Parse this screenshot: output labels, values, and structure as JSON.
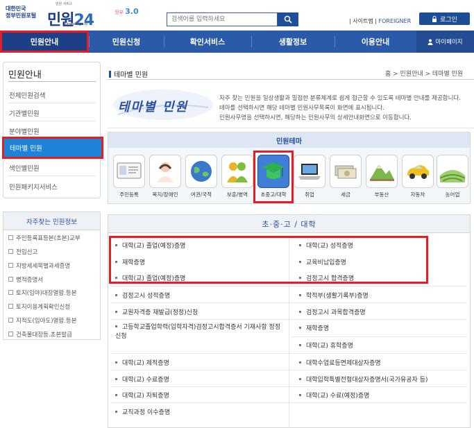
{
  "header": {
    "gov_logo": "대한민국\n정부민원포털",
    "tagline": "민원 서비스",
    "brand": "민원",
    "brand_num": "24",
    "url": "minwon.go.kr",
    "gov30_label": "정부",
    "gov30_num": "3.0",
    "search_placeholder": "검색어를 입력하세요",
    "sitemap": "사이트맵",
    "foreigner": "FOREIGNER",
    "login": "로그인"
  },
  "nav": {
    "items": [
      "민원안내",
      "민원신청",
      "확인서비스",
      "생활정보",
      "이용안내"
    ],
    "mypage": "마이페이지"
  },
  "sidebar": {
    "title": "민원안내",
    "items": [
      "전체민원검색",
      "기관별민원",
      "분야별민원",
      "테마별 민원",
      "색인별민원",
      "민원패키지서비스"
    ],
    "freq_title": "자주찾는 민원정보",
    "freq_items": [
      "주민등록표등본(초본)교부",
      "전입신고",
      "지방세세목별과세증명",
      "병적증명서",
      "토지(임야)대장열람.등본",
      "토지이용계획확인신청",
      "지적도(임야도)열람.등본",
      "건축물대장등.초본발급"
    ]
  },
  "content": {
    "page_title": "테마별 민원",
    "breadcrumb": "홈 > 민원안내 > 테마별 민원",
    "hero_title": "테마별 민원",
    "hero_desc": [
      "자주 찾는 민원을 일상생활과 밀접한 분류체계로 쉽게 접근할 수 있도록 테마별 안내를 제공합니다.",
      "테마를 선택하시면 해당 테마별 민원사무목록이 화면에 표시됩니다.",
      "민원사무명을 선택하시면, 해당하는 민원사무의 상세안내화면으로 이동합니다."
    ],
    "theme_header": "민원테마",
    "themes": [
      {
        "label": "주민등록",
        "icon": "id-card-icon"
      },
      {
        "label": "복지/장애인",
        "icon": "welfare-icon"
      },
      {
        "label": "여권/국적",
        "icon": "globe-icon"
      },
      {
        "label": "보훈/병역",
        "icon": "people-icon"
      },
      {
        "label": "초중고/대학",
        "icon": "graduation-cap-icon"
      },
      {
        "label": "취업",
        "icon": "laptop-icon"
      },
      {
        "label": "세금",
        "icon": "money-icon"
      },
      {
        "label": "부동산",
        "icon": "land-icon"
      },
      {
        "label": "자동차",
        "icon": "car-icon"
      },
      {
        "label": "농어업",
        "icon": "farm-icon"
      }
    ],
    "selected_theme": "초중고/대학",
    "list_header": "초·중·고 / 대학",
    "left_items": [
      "대학(교) 졸업(예정)증명",
      "재학증명",
      "대학(교) 졸업(예정)증명",
      "검정고시 성적증명",
      "교원자격증 재발급(정정)신청",
      "고등학교졸업학력(입학자격)검정고시합격증서 기재사항 정정신청",
      "대학(교) 제적증명",
      "대학(교) 수료증명",
      "대학(교) 자퇴증명",
      "교직과정 이수증명"
    ],
    "right_items": [
      "대학(교) 성적증명",
      "교육비납입증명",
      "검정고시 합격증명",
      "학적부(생활기록부)증명",
      "검정고시 과목합격증명",
      "재학증명",
      "대학(교) 휴학증명",
      "대학수업료등면제대상자증명",
      "대학입학특별전형대상자증명서(국가유공자 등)",
      "대학(교) 수료(예정)증명"
    ]
  }
}
